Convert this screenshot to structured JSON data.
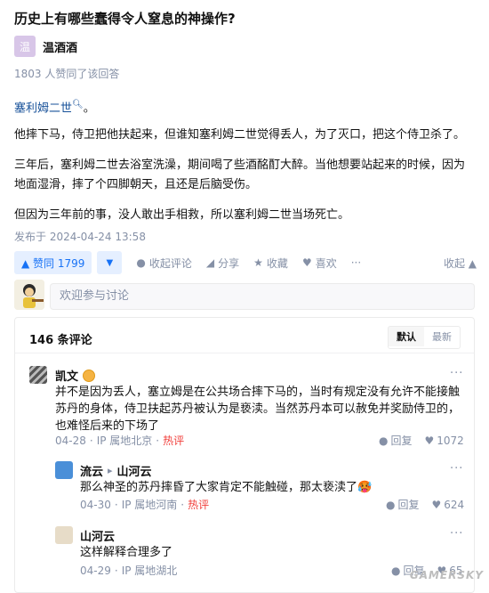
{
  "question": {
    "title": "历史上有哪些蠢得令人窒息的神操作?"
  },
  "author": {
    "name": "温酒酒",
    "avatar_text": "温"
  },
  "answer": {
    "votes_line": "1803 人赞同了该回答",
    "link_text": "塞利姆二世",
    "link_suffix": "。",
    "p1": "他摔下马，侍卫把他扶起来，但谁知塞利姆二世觉得丢人，为了灭口，把这个侍卫杀了。",
    "p2": "三年后，塞利姆二世去浴室洗澡，期间喝了些酒酩酊大醉。当他想要站起来的时候，因为地面湿滑，摔了个四脚朝天，且还是后脑受伤。",
    "p3": "但因为三年前的事，没人敢出手相救，所以塞利姆二世当场死亡。",
    "published": "发布于 2024-04-24 13:58"
  },
  "actions": {
    "vote_label": "▲ 赞同 1799",
    "vote_down": "▼",
    "comment": "收起评论",
    "share": "分享",
    "favorite": "收藏",
    "like": "喜欢",
    "more": "···",
    "collapse": "收起 ▲"
  },
  "comment_box": {
    "placeholder": "欢迎参与讨论"
  },
  "comments": {
    "count": "146 条评论",
    "sort_default": "默认",
    "sort_latest": "最新",
    "items": [
      {
        "name": "凯文",
        "text": "并不是因为丢人，塞立姆是在公共场合摔下马的，当时有规定没有允许不能接触苏丹的身体，侍卫扶起苏丹被认为是亵渎。当然苏丹本可以赦免并奖励侍卫的，也难怪后来的下场了",
        "date": "04-28",
        "ip": "IP 属地北京",
        "hot": "热评",
        "reply": "回复",
        "likes": "1072"
      },
      {
        "name": "流云",
        "reply_to": "山河云",
        "text": "那么神圣的苏丹摔昏了大家肯定不能触碰，那太亵渎了🥵",
        "date": "04-30",
        "ip": "IP 属地河南",
        "hot": "热评",
        "reply": "回复",
        "likes": "624"
      },
      {
        "name": "山河云",
        "text": "这样解释合理多了",
        "date": "04-29",
        "ip": "IP 属地湖北",
        "reply": "回复",
        "likes": "65"
      }
    ]
  },
  "watermark": "GAMERSKY",
  "colors": {
    "accent": "#1772f6",
    "link": "#175199",
    "meta": "#8590a6",
    "hot": "#f1403c"
  }
}
